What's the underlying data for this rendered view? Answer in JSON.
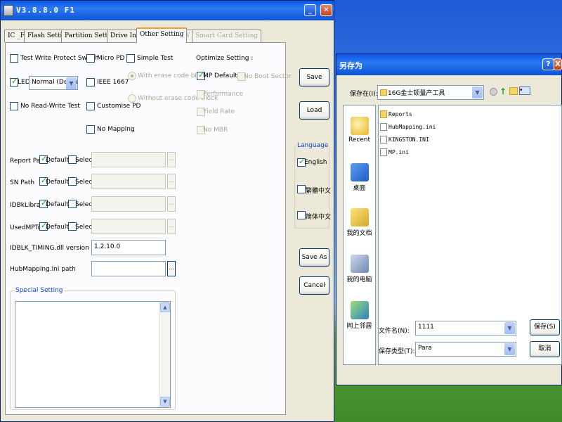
{
  "main_window": {
    "title": "V3.8.8.0 F1",
    "tabs": [
      {
        "label": "IC _FW",
        "state": "normal"
      },
      {
        "label": "Flash Setting",
        "state": "normal"
      },
      {
        "label": "Partition Setting",
        "state": "normal"
      },
      {
        "label": "Drive Info",
        "state": "normal"
      },
      {
        "label": "Other Setting",
        "state": "active"
      },
      {
        "label": "FW",
        "state": "disabled"
      },
      {
        "label": "Smart Card Setting",
        "state": "disabled"
      }
    ],
    "options": {
      "test_write_protect": {
        "label": "Test Write Protect Switch",
        "checked": false
      },
      "led": {
        "label": "LED",
        "checked": true
      },
      "led_mode": "Normal (Default)",
      "no_read_write_test": {
        "label": "No Read-Write Test",
        "checked": false
      },
      "micro_pd": {
        "label": "Micro PD",
        "checked": false
      },
      "ieee_1667": {
        "label": "IEEE 1667",
        "checked": false
      },
      "customise_pd": {
        "label": "Customise PD",
        "checked": false
      },
      "no_mapping": {
        "label": "No Mapping",
        "checked": false
      },
      "simple_test": {
        "label": "Simple Test",
        "checked": false
      },
      "with_erase": {
        "label": "With erase code block",
        "checked": true
      },
      "without_erase": {
        "label": "Without erase code block",
        "checked": false
      }
    },
    "optimize": {
      "title": "Optimize Setting :",
      "mp_default": {
        "label": "MP Default",
        "checked": true
      },
      "no_boot_sector": {
        "label": "No Boot Sector",
        "checked": false
      },
      "performance": {
        "label": "Performance",
        "checked": false
      },
      "yield_rate": {
        "label": "Yield Rate",
        "checked": false
      },
      "no_mbr": {
        "label": "No MBR",
        "checked": false
      }
    },
    "paths": [
      {
        "label": "Report Path :",
        "default_label": "Default",
        "default_checked": true,
        "select_label": "Select",
        "select_checked": false,
        "value": "",
        "browse": "..."
      },
      {
        "label": "SN Path",
        "default_label": "Default",
        "default_checked": true,
        "select_label": "Select",
        "select_checked": false,
        "value": "",
        "browse": "..."
      },
      {
        "label": "IDBkLibrary:",
        "default_label": "Default",
        "default_checked": true,
        "select_label": "Select",
        "select_checked": false,
        "value": "",
        "browse": "..."
      },
      {
        "label": "UsedMPTool:",
        "default_label": "Default",
        "default_checked": true,
        "select_label": "Select",
        "select_checked": false,
        "value": "",
        "browse": "..."
      }
    ],
    "idblk_version": {
      "label": "IDBLK_TIMING.dll version :",
      "value": "1.2.10.0"
    },
    "hubmapping": {
      "label": "HubMapping.ini path",
      "value": "",
      "browse": "..."
    },
    "special_setting": {
      "title": "Special Setting",
      "content": ""
    },
    "buttons": {
      "save": "Save",
      "load": "Load",
      "save_as": "Save As",
      "cancel": "Cancel"
    },
    "language": {
      "title": "Language",
      "options": [
        {
          "label": "English",
          "checked": true
        },
        {
          "label": "繁體中文",
          "checked": false
        },
        {
          "label": "简体中文",
          "checked": false
        }
      ]
    }
  },
  "save_dialog": {
    "title": "另存为",
    "save_in_label": "保存在(I):",
    "save_in_value": "16G金士顿量产工具",
    "places": [
      "Recent",
      "桌面",
      "我的文档",
      "我的电脑",
      "网上邻居"
    ],
    "files": [
      {
        "name": "Reports",
        "type": "folder"
      },
      {
        "name": "HubMapping.ini",
        "type": "file"
      },
      {
        "name": "KINGSTON.INI",
        "type": "file"
      },
      {
        "name": "MP.ini",
        "type": "file"
      }
    ],
    "filename_label": "文件名(N):",
    "filename_value": "1111",
    "filetype_label": "保存类型(T):",
    "filetype_value": "Para",
    "save_button": "保存(S)",
    "cancel_button": "取消",
    "help_button": "?",
    "close_button": "X"
  },
  "colors": {
    "title_blue": "#0b52d8",
    "window_bg": "#ece9d8",
    "check_green": "#21a121",
    "group_title_blue": "#0046d5"
  }
}
